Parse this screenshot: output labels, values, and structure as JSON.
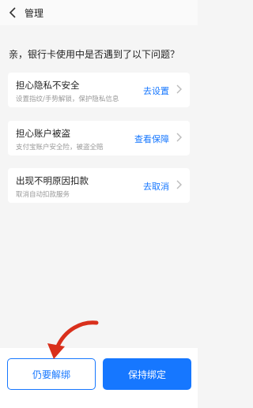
{
  "header": {
    "back_icon": "chevron-left-icon",
    "title": "管理"
  },
  "question": "亲，银行卡使用中是否遇到了以下问题？",
  "cards": [
    {
      "title": "担心隐私不安全",
      "subtitle": "设置指纹/手势解锁，保护隐私信息",
      "action": "去设置",
      "chevron_icon": "chevron-right-icon"
    },
    {
      "title": "担心账户被盗",
      "subtitle": "支付宝账户安全险，被盗全赔",
      "action": "查看保障",
      "chevron_icon": "chevron-right-icon"
    },
    {
      "title": "出现不明原因扣款",
      "subtitle": "取消自动扣款服务",
      "action": "去取消",
      "chevron_icon": "chevron-right-icon"
    }
  ],
  "buttons": {
    "unbind": "仍要解绑",
    "keep": "保持绑定"
  },
  "colors": {
    "accent": "#1677ff",
    "annotation_arrow": "#d9301c"
  }
}
